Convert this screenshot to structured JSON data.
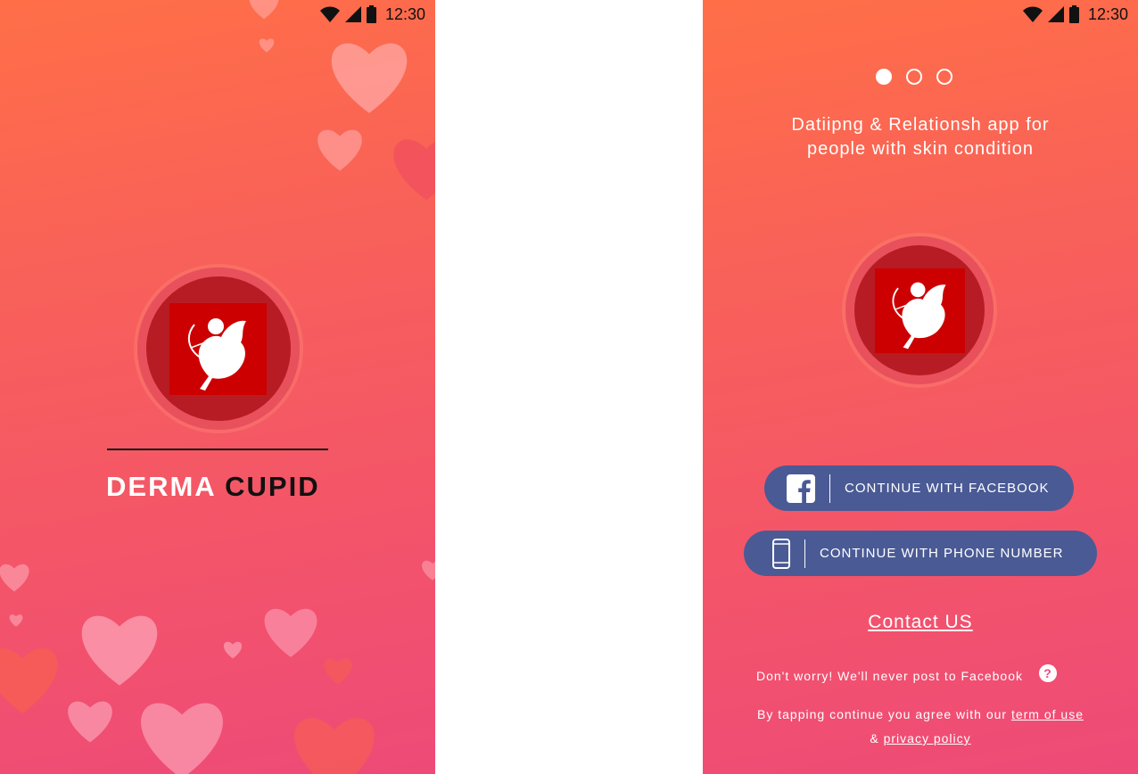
{
  "status_bar": {
    "time": "12:30"
  },
  "splash": {
    "brand_white": "DERMA",
    "brand_black": "CUPID"
  },
  "login": {
    "tagline_line1": "Datiipng & Relationsh app for",
    "tagline_line2": "people with skin condition",
    "pager": {
      "pages": 3,
      "active": 0
    },
    "facebook_button": "CONTINUE WITH FACEBOOK",
    "phone_button": "CONTINUE WITH PHONE NUMBER",
    "contact_link": "Contact US",
    "note": "Don't worry! We'll never post to Facebook",
    "terms_prefix": "By tapping continue you agree with our",
    "terms_link": "term of use",
    "terms_amp": "&",
    "privacy_link": "privacy policy"
  },
  "colors": {
    "gradient_top": "#ff6f47",
    "gradient_bottom": "#ee4a78",
    "button_bg": "#4a5a95",
    "logo_red": "#cc0000"
  },
  "icons": [
    "wifi-icon",
    "signal-icon",
    "battery-icon",
    "cupid-icon",
    "heart-icon",
    "facebook-icon",
    "phone-icon",
    "help-icon"
  ]
}
